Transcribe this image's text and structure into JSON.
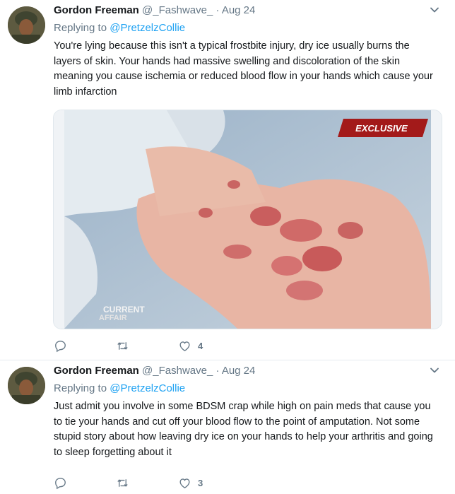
{
  "tweets": [
    {
      "author_name": "Gordon Freeman",
      "handle": "@_Fashwave_",
      "separator": "·",
      "date": "Aug 24",
      "replying_prefix": "Replying to",
      "replying_to": "@PretzelzCollie",
      "text": "You're lying because this isn't a typical frostbite injury, dry ice usually burns the layers of skin. Your hands had massive swelling and discoloration of the skin meaning you cause ischemia or reduced blood flow in your hands which cause your limb infarction",
      "media": {
        "badge": "EXCLUSIVE",
        "watermark_top": "CURRENT",
        "watermark_bottom": "AFFAIR"
      },
      "like_count": "4"
    },
    {
      "author_name": "Gordon Freeman",
      "handle": "@_Fashwave_",
      "separator": "·",
      "date": "Aug 24",
      "replying_prefix": "Replying to",
      "replying_to": "@PretzelzCollie",
      "text": "Just admit you involve in some BDSM crap while high on pain meds that cause you to tie your hands and cut off your blood flow to the point of amputation. Not some stupid story about how leaving dry ice on your hands to help your arthritis and going to sleep forgetting about it",
      "like_count": "3"
    }
  ],
  "colors": {
    "link": "#1da1f2",
    "muted": "#657786",
    "text": "#14171a"
  },
  "icons": [
    "avatar",
    "chevron-down-icon",
    "reply-icon",
    "retweet-icon",
    "like-icon"
  ]
}
